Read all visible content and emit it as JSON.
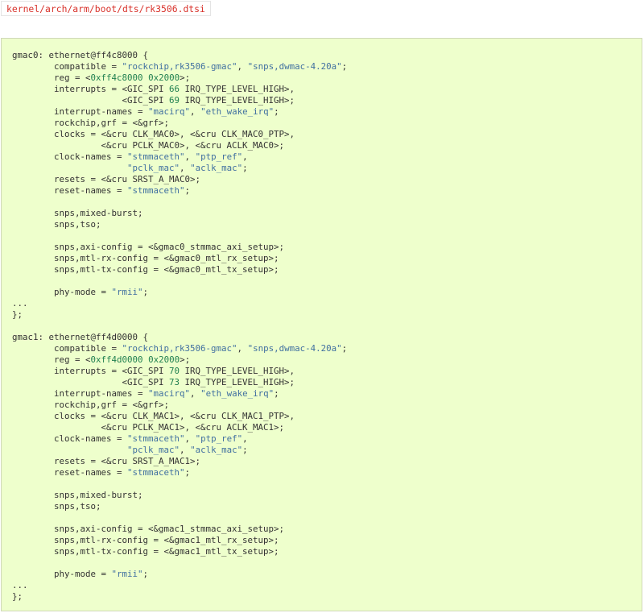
{
  "file_path": "kernel/arch/arm/boot/dts/rk3506.dtsi",
  "colors": {
    "path_text": "#d8322b",
    "code_background": "#eeffcc",
    "string": "#4070a0",
    "number": "#208050",
    "plain": "#333333"
  },
  "code_lines": [
    [
      {
        "t": "p",
        "v": "gmac0: ethernet@ff4c8000 {"
      }
    ],
    [
      {
        "t": "p",
        "v": "\tcompatible = "
      },
      {
        "t": "s",
        "v": "\"rockchip,rk3506-gmac\""
      },
      {
        "t": "p",
        "v": ", "
      },
      {
        "t": "s",
        "v": "\"snps,dwmac-4.20a\""
      },
      {
        "t": "p",
        "v": ";"
      }
    ],
    [
      {
        "t": "p",
        "v": "\treg = <"
      },
      {
        "t": "n",
        "v": "0xff4c8000"
      },
      {
        "t": "p",
        "v": " "
      },
      {
        "t": "n",
        "v": "0x2000"
      },
      {
        "t": "p",
        "v": ">;"
      }
    ],
    [
      {
        "t": "p",
        "v": "\tinterrupts = <GIC_SPI "
      },
      {
        "t": "n",
        "v": "66"
      },
      {
        "t": "p",
        "v": " IRQ_TYPE_LEVEL_HIGH>,"
      }
    ],
    [
      {
        "t": "p",
        "v": "\t\t     <GIC_SPI "
      },
      {
        "t": "n",
        "v": "69"
      },
      {
        "t": "p",
        "v": " IRQ_TYPE_LEVEL_HIGH>;"
      }
    ],
    [
      {
        "t": "p",
        "v": "\tinterrupt-names = "
      },
      {
        "t": "s",
        "v": "\"macirq\""
      },
      {
        "t": "p",
        "v": ", "
      },
      {
        "t": "s",
        "v": "\"eth_wake_irq\""
      },
      {
        "t": "p",
        "v": ";"
      }
    ],
    [
      {
        "t": "p",
        "v": "\trockchip,grf = <&grf>;"
      }
    ],
    [
      {
        "t": "p",
        "v": "\tclocks = <&cru CLK_MAC0>, <&cru CLK_MAC0_PTP>,"
      }
    ],
    [
      {
        "t": "p",
        "v": "\t\t <&cru PCLK_MAC0>, <&cru ACLK_MAC0>;"
      }
    ],
    [
      {
        "t": "p",
        "v": "\tclock-names = "
      },
      {
        "t": "s",
        "v": "\"stmmaceth\""
      },
      {
        "t": "p",
        "v": ", "
      },
      {
        "t": "s",
        "v": "\"ptp_ref\""
      },
      {
        "t": "p",
        "v": ","
      }
    ],
    [
      {
        "t": "p",
        "v": "\t\t      "
      },
      {
        "t": "s",
        "v": "\"pclk_mac\""
      },
      {
        "t": "p",
        "v": ", "
      },
      {
        "t": "s",
        "v": "\"aclk_mac\""
      },
      {
        "t": "p",
        "v": ";"
      }
    ],
    [
      {
        "t": "p",
        "v": "\tresets = <&cru SRST_A_MAC0>;"
      }
    ],
    [
      {
        "t": "p",
        "v": "\treset-names = "
      },
      {
        "t": "s",
        "v": "\"stmmaceth\""
      },
      {
        "t": "p",
        "v": ";"
      }
    ],
    [],
    [
      {
        "t": "p",
        "v": "\tsnps,mixed-burst;"
      }
    ],
    [
      {
        "t": "p",
        "v": "\tsnps,tso;"
      }
    ],
    [],
    [
      {
        "t": "p",
        "v": "\tsnps,axi-config = <&gmac0_stmmac_axi_setup>;"
      }
    ],
    [
      {
        "t": "p",
        "v": "\tsnps,mtl-rx-config = <&gmac0_mtl_rx_setup>;"
      }
    ],
    [
      {
        "t": "p",
        "v": "\tsnps,mtl-tx-config = <&gmac0_mtl_tx_setup>;"
      }
    ],
    [],
    [
      {
        "t": "p",
        "v": "\tphy-mode = "
      },
      {
        "t": "s",
        "v": "\"rmii\""
      },
      {
        "t": "p",
        "v": ";"
      }
    ],
    [
      {
        "t": "p",
        "v": "..."
      }
    ],
    [
      {
        "t": "p",
        "v": "};"
      }
    ],
    [],
    [
      {
        "t": "p",
        "v": "gmac1: ethernet@ff4d0000 {"
      }
    ],
    [
      {
        "t": "p",
        "v": "\tcompatible = "
      },
      {
        "t": "s",
        "v": "\"rockchip,rk3506-gmac\""
      },
      {
        "t": "p",
        "v": ", "
      },
      {
        "t": "s",
        "v": "\"snps,dwmac-4.20a\""
      },
      {
        "t": "p",
        "v": ";"
      }
    ],
    [
      {
        "t": "p",
        "v": "\treg = <"
      },
      {
        "t": "n",
        "v": "0xff4d0000"
      },
      {
        "t": "p",
        "v": " "
      },
      {
        "t": "n",
        "v": "0x2000"
      },
      {
        "t": "p",
        "v": ">;"
      }
    ],
    [
      {
        "t": "p",
        "v": "\tinterrupts = <GIC_SPI "
      },
      {
        "t": "n",
        "v": "70"
      },
      {
        "t": "p",
        "v": " IRQ_TYPE_LEVEL_HIGH>,"
      }
    ],
    [
      {
        "t": "p",
        "v": "\t\t     <GIC_SPI "
      },
      {
        "t": "n",
        "v": "73"
      },
      {
        "t": "p",
        "v": " IRQ_TYPE_LEVEL_HIGH>;"
      }
    ],
    [
      {
        "t": "p",
        "v": "\tinterrupt-names = "
      },
      {
        "t": "s",
        "v": "\"macirq\""
      },
      {
        "t": "p",
        "v": ", "
      },
      {
        "t": "s",
        "v": "\"eth_wake_irq\""
      },
      {
        "t": "p",
        "v": ";"
      }
    ],
    [
      {
        "t": "p",
        "v": "\trockchip,grf = <&grf>;"
      }
    ],
    [
      {
        "t": "p",
        "v": "\tclocks = <&cru CLK_MAC1>, <&cru CLK_MAC1_PTP>,"
      }
    ],
    [
      {
        "t": "p",
        "v": "\t\t <&cru PCLK_MAC1>, <&cru ACLK_MAC1>;"
      }
    ],
    [
      {
        "t": "p",
        "v": "\tclock-names = "
      },
      {
        "t": "s",
        "v": "\"stmmaceth\""
      },
      {
        "t": "p",
        "v": ", "
      },
      {
        "t": "s",
        "v": "\"ptp_ref\""
      },
      {
        "t": "p",
        "v": ","
      }
    ],
    [
      {
        "t": "p",
        "v": "\t\t      "
      },
      {
        "t": "s",
        "v": "\"pclk_mac\""
      },
      {
        "t": "p",
        "v": ", "
      },
      {
        "t": "s",
        "v": "\"aclk_mac\""
      },
      {
        "t": "p",
        "v": ";"
      }
    ],
    [
      {
        "t": "p",
        "v": "\tresets = <&cru SRST_A_MAC1>;"
      }
    ],
    [
      {
        "t": "p",
        "v": "\treset-names = "
      },
      {
        "t": "s",
        "v": "\"stmmaceth\""
      },
      {
        "t": "p",
        "v": ";"
      }
    ],
    [],
    [
      {
        "t": "p",
        "v": "\tsnps,mixed-burst;"
      }
    ],
    [
      {
        "t": "p",
        "v": "\tsnps,tso;"
      }
    ],
    [],
    [
      {
        "t": "p",
        "v": "\tsnps,axi-config = <&gmac1_stmmac_axi_setup>;"
      }
    ],
    [
      {
        "t": "p",
        "v": "\tsnps,mtl-rx-config = <&gmac1_mtl_rx_setup>;"
      }
    ],
    [
      {
        "t": "p",
        "v": "\tsnps,mtl-tx-config = <&gmac1_mtl_tx_setup>;"
      }
    ],
    [],
    [
      {
        "t": "p",
        "v": "\tphy-mode = "
      },
      {
        "t": "s",
        "v": "\"rmii\""
      },
      {
        "t": "p",
        "v": ";"
      }
    ],
    [
      {
        "t": "p",
        "v": "..."
      }
    ],
    [
      {
        "t": "p",
        "v": "};"
      }
    ]
  ]
}
